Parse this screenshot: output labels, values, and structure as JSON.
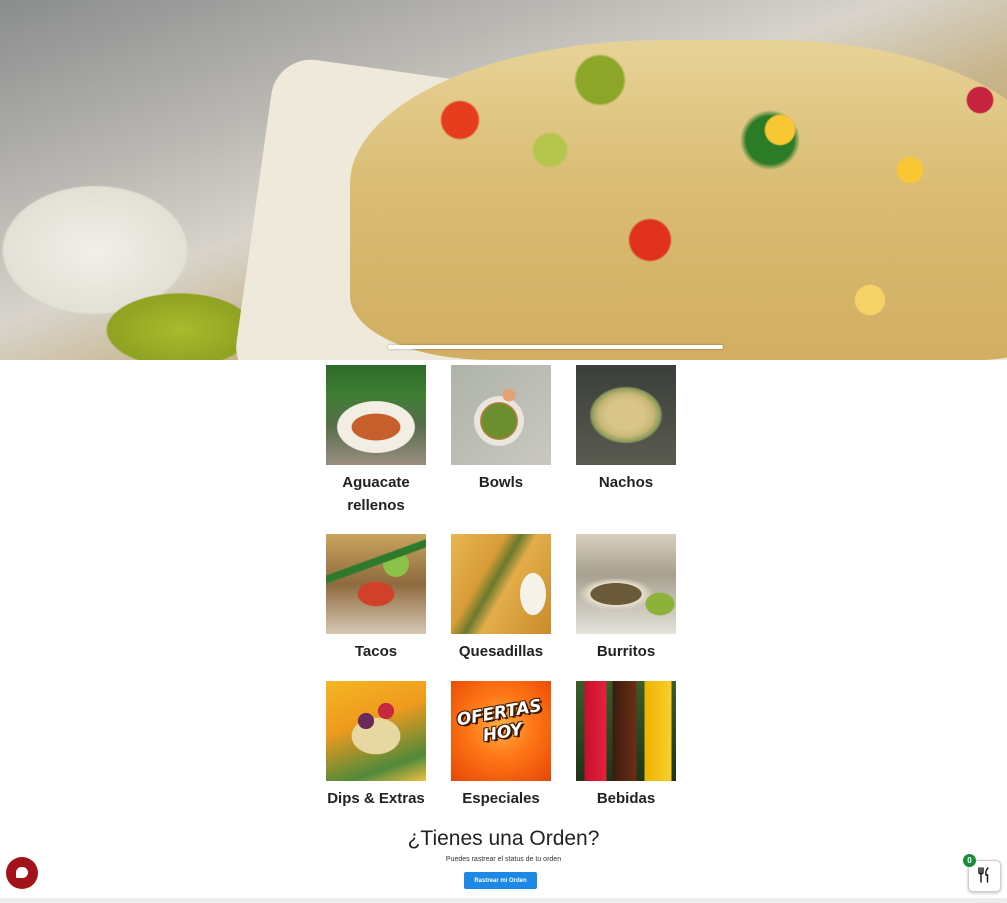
{
  "hero": {
    "image": "nachos-with-guacamole-banner",
    "slider_indicator": "active-slide"
  },
  "categories": [
    {
      "label": "Aguacate rellenos",
      "image": "stuffed-avocado-photo"
    },
    {
      "label": "Bowls",
      "image": "bowl-photo"
    },
    {
      "label": "Nachos",
      "image": "nachos-photo"
    },
    {
      "label": "Tacos",
      "image": "tacos-photo"
    },
    {
      "label": "Quesadillas",
      "image": "quesadillas-photo"
    },
    {
      "label": "Burritos",
      "image": "burritos-photo"
    },
    {
      "label": "Dips & Extras",
      "image": "dips-photo"
    },
    {
      "label": "Especiales",
      "image": "ofertas-hoy-graphic",
      "image_text": "OFERTAS HOY"
    },
    {
      "label": "Bebidas",
      "image": "drinks-photo"
    }
  ],
  "order": {
    "title": "¿Tienes una Orden?",
    "subtitle": "Puedes rastrear el status de tu orden",
    "button_label": "Rastrear mi Orden"
  },
  "chat": {
    "icon": "chat-bubble-icon",
    "color": "#a3131a"
  },
  "cart": {
    "icon": "fork-knife-icon",
    "count": "0",
    "badge_color": "#1b8a3a"
  },
  "colors": {
    "accent": "#1e88e5",
    "text": "#222222"
  }
}
